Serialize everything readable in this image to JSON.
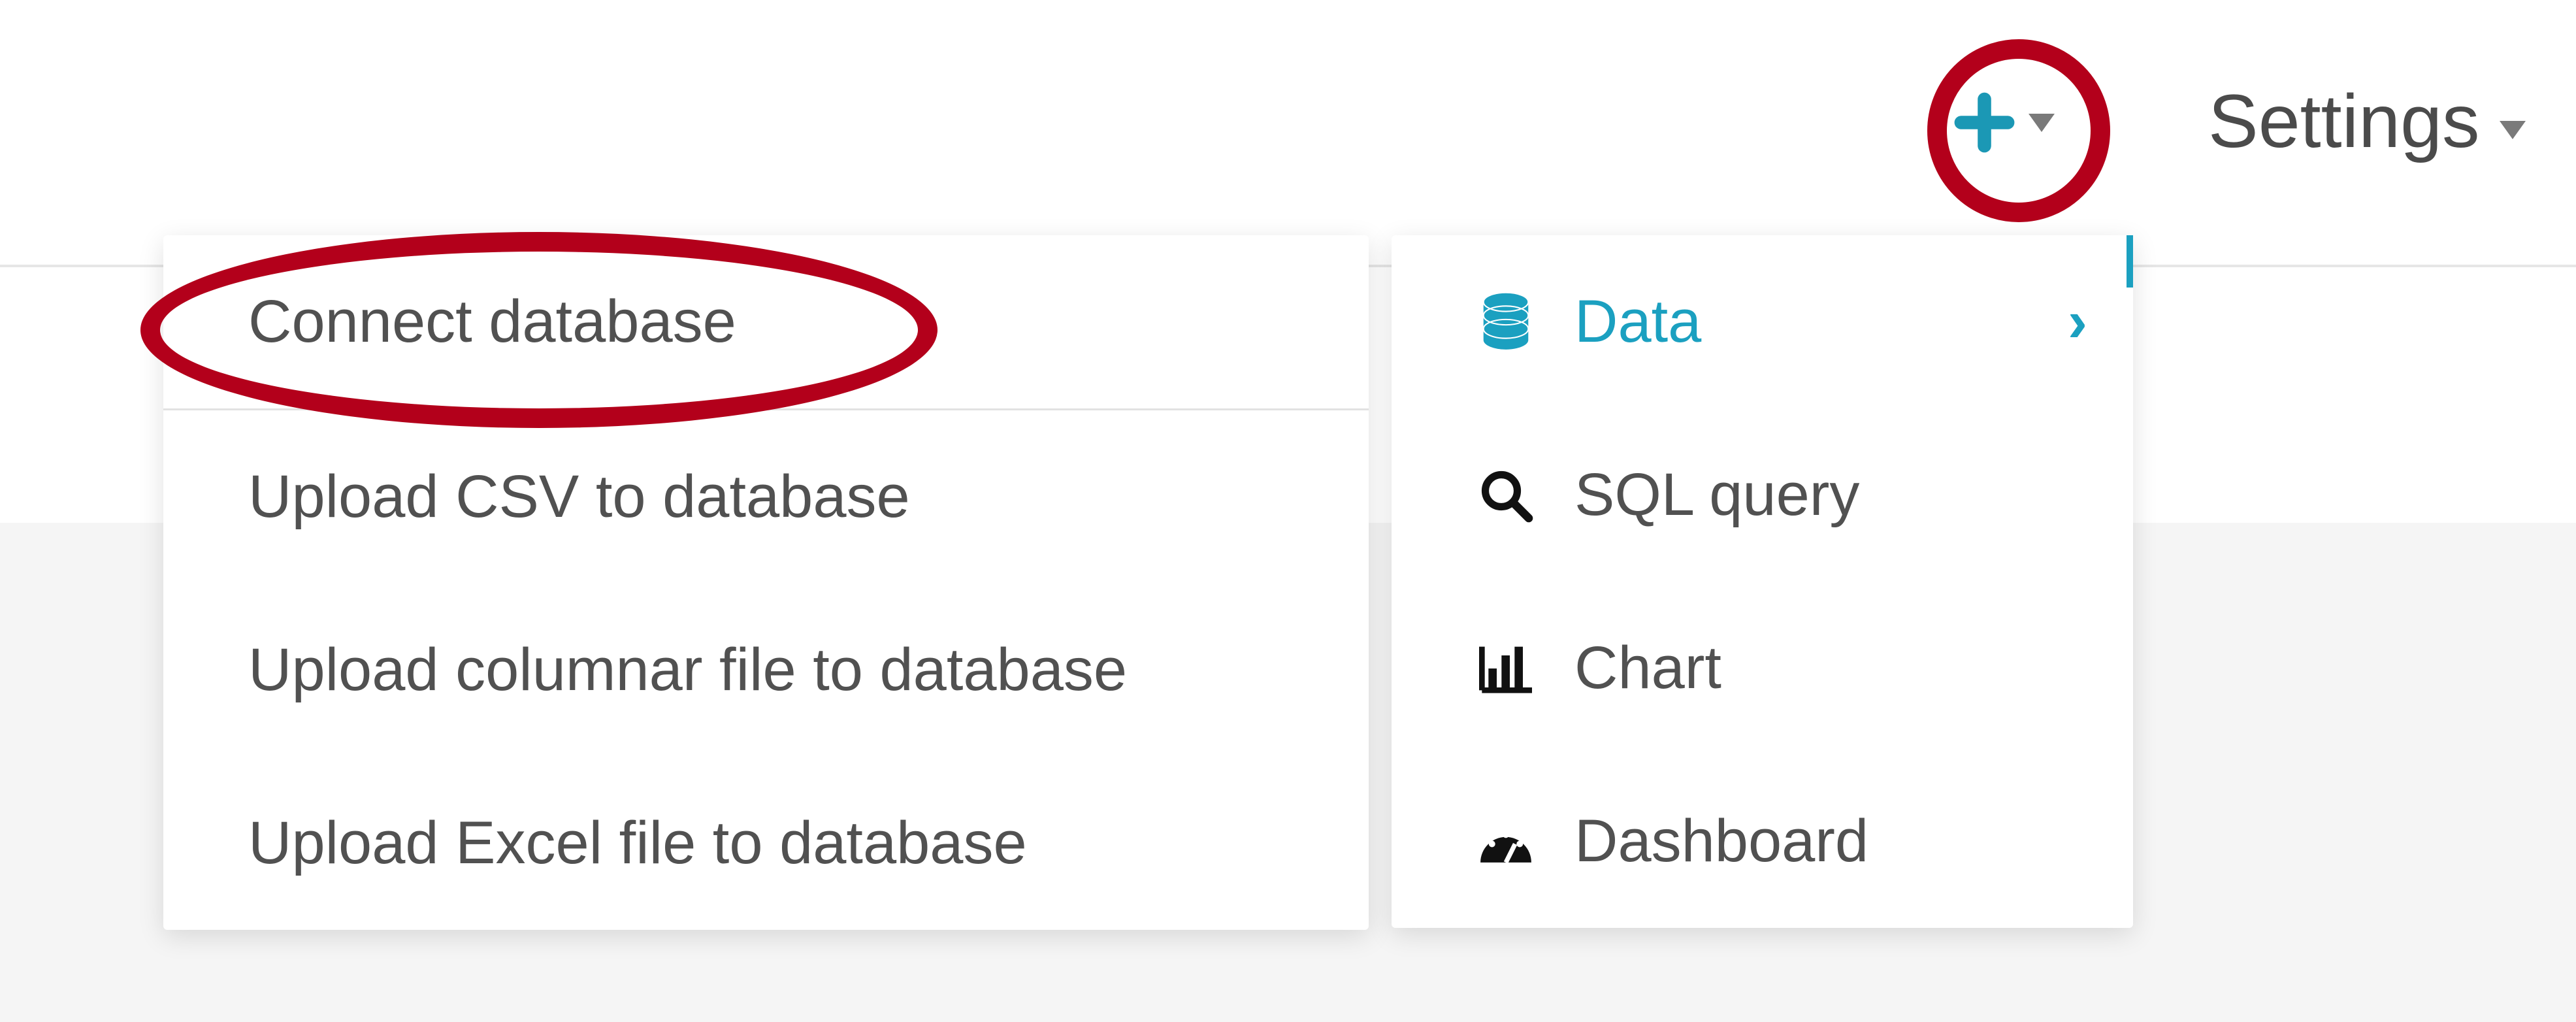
{
  "nav": {
    "settings_label": "Settings"
  },
  "add_menu": {
    "items": [
      {
        "label": "Data",
        "active": true,
        "has_children": true
      },
      {
        "label": "SQL query",
        "active": false,
        "has_children": false
      },
      {
        "label": "Chart",
        "active": false,
        "has_children": false
      },
      {
        "label": "Dashboard",
        "active": false,
        "has_children": false
      }
    ]
  },
  "data_submenu": {
    "items": [
      {
        "label": "Connect database"
      },
      {
        "label": "Upload CSV to database"
      },
      {
        "label": "Upload columnar file to database"
      },
      {
        "label": "Upload Excel file to database"
      }
    ]
  },
  "annotations": {
    "highlight_add_button": true,
    "highlight_connect_database": true
  },
  "colors": {
    "accent": "#1ba0c0",
    "highlight": "#b3001b",
    "text": "#4b4b4b"
  }
}
